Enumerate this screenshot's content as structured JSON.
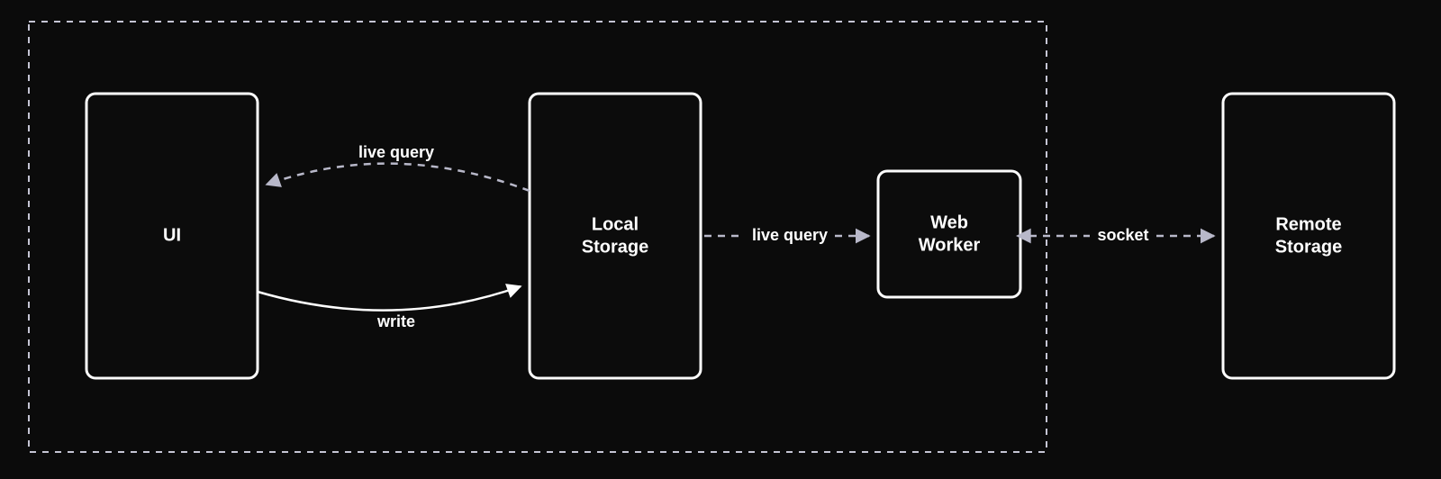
{
  "nodes": {
    "ui": {
      "label": "UI"
    },
    "local_storage": {
      "label_line1": "Local",
      "label_line2": "Storage"
    },
    "web_worker": {
      "label_line1": "Web",
      "label_line2": "Worker"
    },
    "remote_storage": {
      "label_line1": "Remote",
      "label_line2": "Storage"
    }
  },
  "edges": {
    "live_query_ls_to_ui": {
      "label": "live query"
    },
    "write_ui_to_ls": {
      "label": "write"
    },
    "live_query_ls_to_ww": {
      "label": "live query"
    },
    "socket_ww_to_rs": {
      "label": "socket"
    }
  }
}
